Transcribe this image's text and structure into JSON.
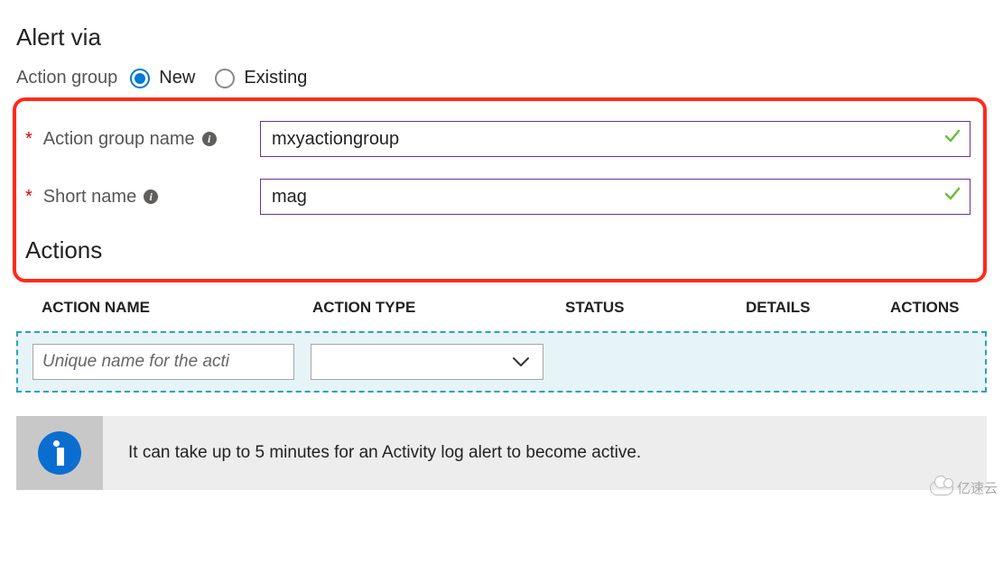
{
  "section_title": "Alert via",
  "action_group": {
    "label": "Action group",
    "options": {
      "new": "New",
      "existing": "Existing"
    },
    "selected": "new"
  },
  "fields": {
    "group_name": {
      "label": "Action group name",
      "value": "mxyactiongroup",
      "required": true,
      "valid": true
    },
    "short_name": {
      "label": "Short name",
      "value": "mag",
      "required": true,
      "valid": true
    }
  },
  "actions": {
    "title": "Actions",
    "columns": [
      "ACTION NAME",
      "ACTION TYPE",
      "STATUS",
      "DETAILS",
      "ACTIONS"
    ],
    "row": {
      "name_placeholder": "Unique name for the acti",
      "type_value": ""
    }
  },
  "info_banner": {
    "message": "It can take up to 5 minutes for an Activity log alert to become active."
  },
  "watermark": "亿速云"
}
